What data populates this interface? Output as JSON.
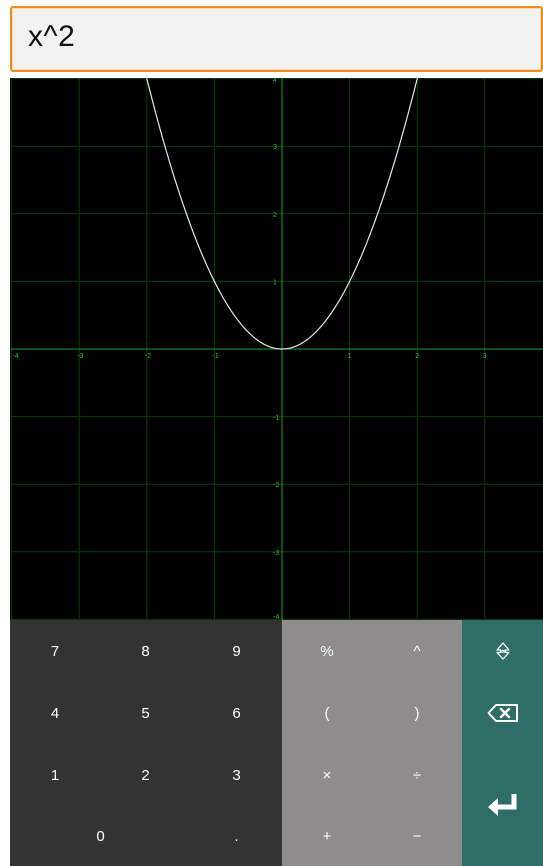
{
  "expression": {
    "value": "x^2"
  },
  "chart_data": {
    "type": "line",
    "title": "",
    "xlabel": "",
    "ylabel": "",
    "xlim": [
      -4,
      3.8
    ],
    "ylim": [
      -4,
      4
    ],
    "grid": true,
    "x_ticks": [
      "-4",
      "-3",
      "-2",
      "-1",
      "1",
      "2",
      "3"
    ],
    "y_ticks": [
      "4",
      "3",
      "2",
      "1",
      "-1",
      "-2",
      "-3",
      "-4"
    ],
    "series": [
      {
        "function": "x^2",
        "x": [
          -2.0,
          -1.75,
          -1.5,
          -1.25,
          -1.0,
          -0.75,
          -0.5,
          -0.25,
          0,
          0.25,
          0.5,
          0.75,
          1.0,
          1.25,
          1.5,
          1.75,
          2.0
        ],
        "y": [
          4.0,
          3.0625,
          2.25,
          1.5625,
          1.0,
          0.5625,
          0.25,
          0.0625,
          0,
          0.0625,
          0.25,
          0.5625,
          1.0,
          1.5625,
          2.25,
          3.0625,
          4.0
        ]
      }
    ],
    "colors": {
      "background": "#000000",
      "grid": "#0c3d0c",
      "axes": "#1fa01f",
      "tick_labels": "#2bc42b",
      "curve": "#e6e6e6"
    }
  },
  "keypad": {
    "digits": [
      "7",
      "8",
      "9",
      "4",
      "5",
      "6",
      "1",
      "2",
      "3",
      "0",
      "."
    ],
    "operators": [
      "%",
      "^",
      "(",
      ")",
      "×",
      "÷",
      "+",
      "−"
    ],
    "actions": {
      "shift_icon": "shift-arrow-icon",
      "backspace_icon": "backspace-icon",
      "enter_icon": "enter-icon"
    },
    "colors": {
      "digits_bg": "#333333",
      "operators_bg": "#8e8c8c",
      "actions_bg": "#2f6e68",
      "key_text": "#ffffff"
    }
  }
}
